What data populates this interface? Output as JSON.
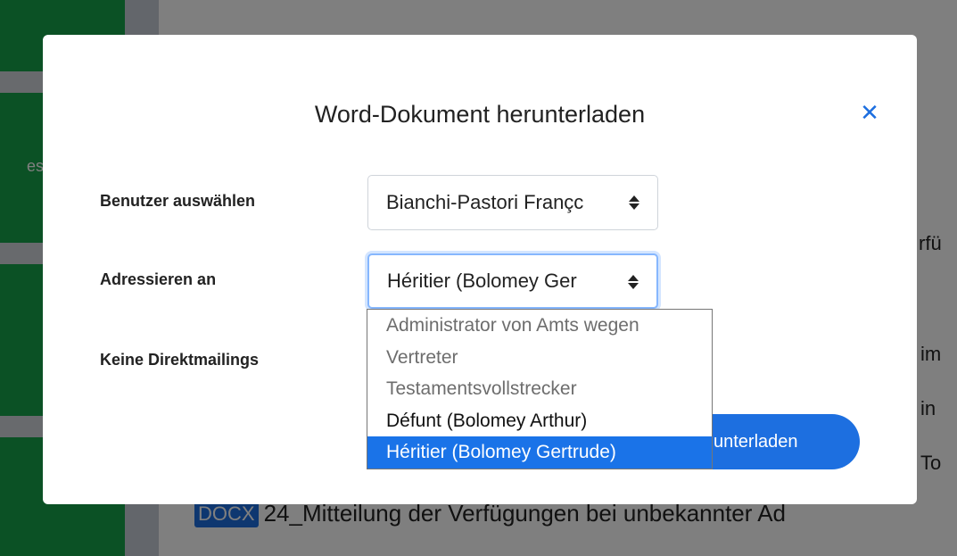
{
  "background": {
    "sidebar_label_partial": "es",
    "right_text_1": "rfü",
    "right_text_2": "im",
    "right_text_3": "in",
    "right_text_4": "To",
    "doc_badge": "DOCX",
    "doc_title": "24_Mitteilung der Verfügungen bei unbekannter Ad"
  },
  "modal": {
    "title": "Word-Dokument herunterladen",
    "close_glyph": "✕",
    "fields": {
      "user_label": "Benutzer auswählen",
      "user_value": "Bianchi-Pastori Françc",
      "address_label": "Adressieren an",
      "address_value": "Héritier (Bolomey Ger",
      "no_mailings_label": "Keine Direktmailings"
    },
    "download_button_partial": "unterladen"
  },
  "dropdown": {
    "options": [
      {
        "label": "Administrator von Amts wegen",
        "state": "disabled"
      },
      {
        "label": "Vertreter",
        "state": "disabled"
      },
      {
        "label": "Testamentsvollstrecker",
        "state": "disabled"
      },
      {
        "label": "Défunt (Bolomey Arthur)",
        "state": "enabled"
      },
      {
        "label": "Héritier (Bolomey Gertrude)",
        "state": "selected"
      }
    ]
  },
  "colors": {
    "accent": "#1d6fe0",
    "sidebar": "#16a34a",
    "selected_option": "#1a73e8"
  },
  "icons": {
    "close": "close-icon",
    "select_arrows": "sort-arrows-icon"
  }
}
